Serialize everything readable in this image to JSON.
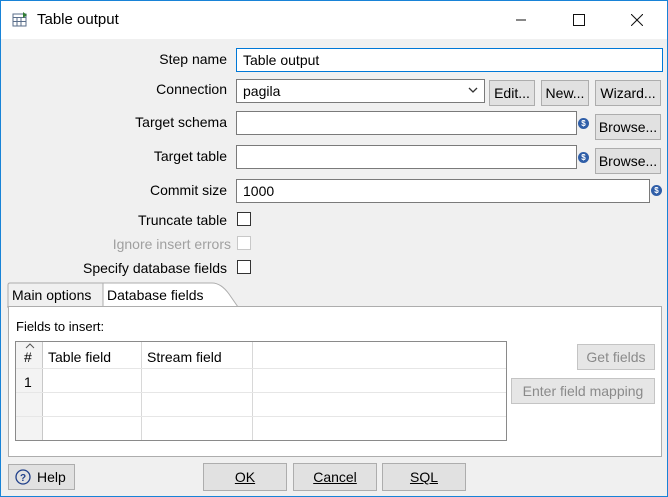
{
  "window": {
    "title": "Table output",
    "minimize": "—",
    "maximize": "☐",
    "close": "✕"
  },
  "form": {
    "step_name_label": "Step name",
    "step_name_value": "Table output",
    "connection_label": "Connection",
    "connection_value": "pagila",
    "edit_label": "Edit...",
    "new_label": "New...",
    "wizard_label": "Wizard...",
    "target_schema_label": "Target schema",
    "target_schema_value": "",
    "target_table_label": "Target table",
    "target_table_value": "",
    "browse_label": "Browse...",
    "commit_size_label": "Commit size",
    "commit_size_value": "1000",
    "truncate_label": "Truncate table",
    "ignore_errors_label": "Ignore insert errors",
    "specify_fields_label": "Specify database fields"
  },
  "tabs": {
    "main": "Main options",
    "database": "Database fields"
  },
  "fields_panel": {
    "caption": "Fields to insert:",
    "columns": [
      "#",
      "Table field",
      "Stream field"
    ],
    "rows": [
      [
        "1",
        "",
        ""
      ]
    ],
    "get_fields": "Get fields",
    "enter_mapping": "Enter field mapping"
  },
  "footer": {
    "help": "Help",
    "ok": "OK",
    "cancel": "Cancel",
    "sql": "SQL"
  },
  "icons": {
    "variable": "dollar-variable-icon",
    "help": "question-circle-icon"
  }
}
